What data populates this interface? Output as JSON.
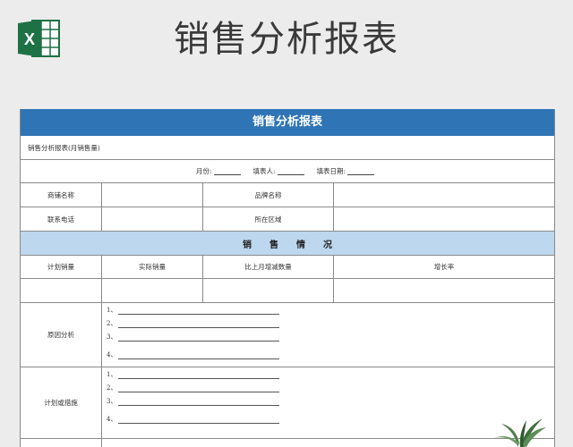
{
  "page": {
    "title": "销售分析报表"
  },
  "sheet": {
    "header": "销售分析报表",
    "subtitle": "销售分析报表(月销售量)",
    "meta": {
      "month_label": "月份:",
      "filler_label": "填表人:",
      "date_label": "填表日期:"
    },
    "store_name_label": "商铺名称",
    "brand_name_label": "品牌名称",
    "phone_label": "联系电话",
    "region_label": "所在区域",
    "section_title": "销售情况",
    "columns": [
      "计划销量",
      "实际销量",
      "比上月增减数量",
      "增长率"
    ],
    "reason_label": "原因分析",
    "plan_label": "计划或措施",
    "line_numbers": [
      "1、",
      "2、",
      "3、",
      "4、"
    ]
  },
  "colors": {
    "header_blue": "#2f74b5",
    "band_blue": "#bdd7ee",
    "excel_green": "#1e7145"
  }
}
